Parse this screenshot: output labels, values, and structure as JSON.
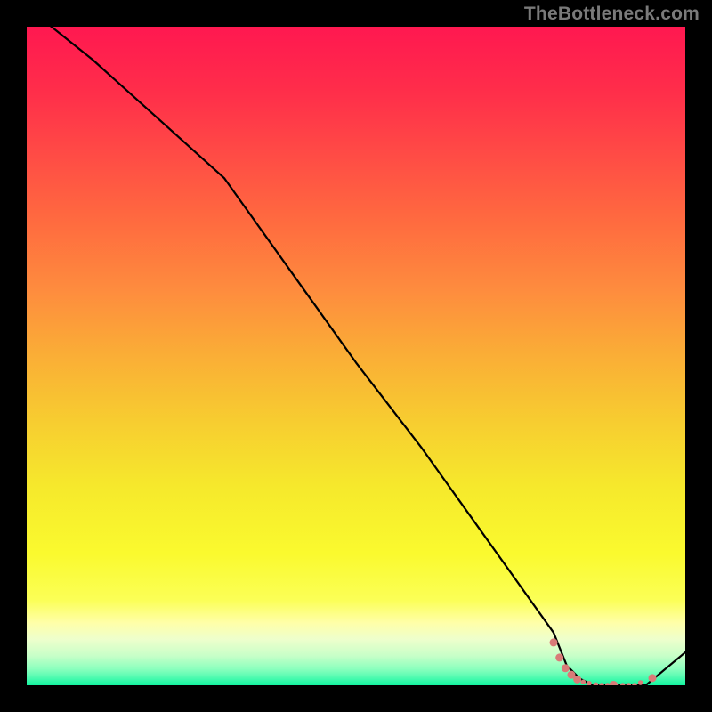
{
  "watermark": "TheBottleneck.com",
  "chart_data": {
    "type": "line",
    "title": "",
    "xlabel": "",
    "ylabel": "",
    "xlim": [
      0,
      100
    ],
    "ylim": [
      0,
      100
    ],
    "grid": false,
    "series": [
      {
        "name": "curve",
        "color": "#000000",
        "x": [
          0,
          10,
          20,
          30,
          40,
          50,
          60,
          70,
          80,
          82,
          84,
          86,
          88,
          90,
          92,
          94,
          100
        ],
        "y": [
          103,
          95,
          86,
          77,
          63,
          49,
          36,
          22,
          8,
          3,
          1,
          0,
          0,
          0,
          0,
          0,
          5
        ]
      }
    ],
    "markers": [
      {
        "x": 80.0,
        "y": 6.5,
        "size": 4.5,
        "color": "#D97B78"
      },
      {
        "x": 80.9,
        "y": 4.2,
        "size": 4.5,
        "color": "#D97B78"
      },
      {
        "x": 81.8,
        "y": 2.6,
        "size": 4.5,
        "color": "#D97B78"
      },
      {
        "x": 82.7,
        "y": 1.6,
        "size": 4.5,
        "color": "#D97B78"
      },
      {
        "x": 83.6,
        "y": 0.9,
        "size": 4.5,
        "color": "#D97B78"
      },
      {
        "x": 84.5,
        "y": 0.5,
        "size": 2.8,
        "color": "#D97B78"
      },
      {
        "x": 85.4,
        "y": 0.3,
        "size": 2.8,
        "color": "#D97B78"
      },
      {
        "x": 86.4,
        "y": 0.1,
        "size": 2.8,
        "color": "#D97B78"
      },
      {
        "x": 87.3,
        "y": 0.0,
        "size": 2.8,
        "color": "#D97B78"
      },
      {
        "x": 88.2,
        "y": 0.0,
        "size": 2.8,
        "color": "#D97B78"
      },
      {
        "x": 89.1,
        "y": 0.0,
        "size": 5.0,
        "color": "#D97B78"
      },
      {
        "x": 90.5,
        "y": 0.0,
        "size": 2.8,
        "color": "#D97B78"
      },
      {
        "x": 91.4,
        "y": 0.0,
        "size": 2.8,
        "color": "#D97B78"
      },
      {
        "x": 92.3,
        "y": 0.0,
        "size": 2.8,
        "color": "#D97B78"
      },
      {
        "x": 93.2,
        "y": 0.4,
        "size": 2.8,
        "color": "#D97B78"
      },
      {
        "x": 95.0,
        "y": 1.1,
        "size": 4.5,
        "color": "#D97B78"
      }
    ],
    "gradient_stops": [
      {
        "offset": 0.0,
        "color": "#FF1850"
      },
      {
        "offset": 0.1,
        "color": "#FF2E4A"
      },
      {
        "offset": 0.2,
        "color": "#FF4D45"
      },
      {
        "offset": 0.3,
        "color": "#FF6C3F"
      },
      {
        "offset": 0.4,
        "color": "#FE8C3E"
      },
      {
        "offset": 0.5,
        "color": "#FAAE36"
      },
      {
        "offset": 0.6,
        "color": "#F7CD30"
      },
      {
        "offset": 0.7,
        "color": "#F6E92C"
      },
      {
        "offset": 0.8,
        "color": "#FAFA2E"
      },
      {
        "offset": 0.87,
        "color": "#FBFF56"
      },
      {
        "offset": 0.905,
        "color": "#FFFFA8"
      },
      {
        "offset": 0.93,
        "color": "#EEFFCC"
      },
      {
        "offset": 0.955,
        "color": "#C8FFC8"
      },
      {
        "offset": 0.975,
        "color": "#8CFFBE"
      },
      {
        "offset": 0.985,
        "color": "#5FFCB4"
      },
      {
        "offset": 1.0,
        "color": "#11F5A0"
      }
    ]
  }
}
